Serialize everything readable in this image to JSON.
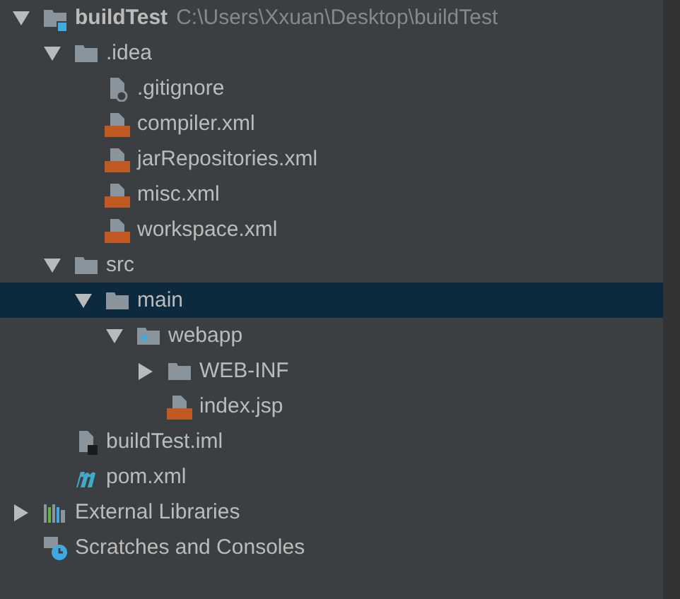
{
  "tree": [
    {
      "label": "buildTest",
      "path": "C:\\Users\\Xxuan\\Desktop\\buildTest",
      "kind": "module",
      "expanded": true,
      "selected": false,
      "children": [
        {
          "label": ".idea",
          "kind": "folder",
          "expanded": true,
          "selected": false,
          "children": [
            {
              "label": ".gitignore",
              "kind": "ignore",
              "selected": false
            },
            {
              "label": "compiler.xml",
              "kind": "xml",
              "selected": false
            },
            {
              "label": "jarRepositories.xml",
              "kind": "xml",
              "selected": false
            },
            {
              "label": "misc.xml",
              "kind": "xml",
              "selected": false
            },
            {
              "label": "workspace.xml",
              "kind": "xml",
              "selected": false
            }
          ]
        },
        {
          "label": "src",
          "kind": "folder",
          "expanded": true,
          "selected": false,
          "children": [
            {
              "label": "main",
              "kind": "folder",
              "expanded": true,
              "selected": true,
              "children": [
                {
                  "label": "webapp",
                  "kind": "web",
                  "expanded": true,
                  "selected": false,
                  "children": [
                    {
                      "label": "WEB-INF",
                      "kind": "folder",
                      "expanded": false,
                      "selected": false
                    },
                    {
                      "label": "index.jsp",
                      "kind": "jsp",
                      "selected": false
                    }
                  ]
                }
              ]
            }
          ]
        },
        {
          "label": "buildTest.iml",
          "kind": "iml",
          "selected": false
        },
        {
          "label": "pom.xml",
          "kind": "maven",
          "selected": false
        }
      ]
    },
    {
      "label": "External Libraries",
      "kind": "libraries",
      "expanded": false,
      "selected": false
    },
    {
      "label": "Scratches and Consoles",
      "kind": "scratches",
      "selected": false
    }
  ]
}
